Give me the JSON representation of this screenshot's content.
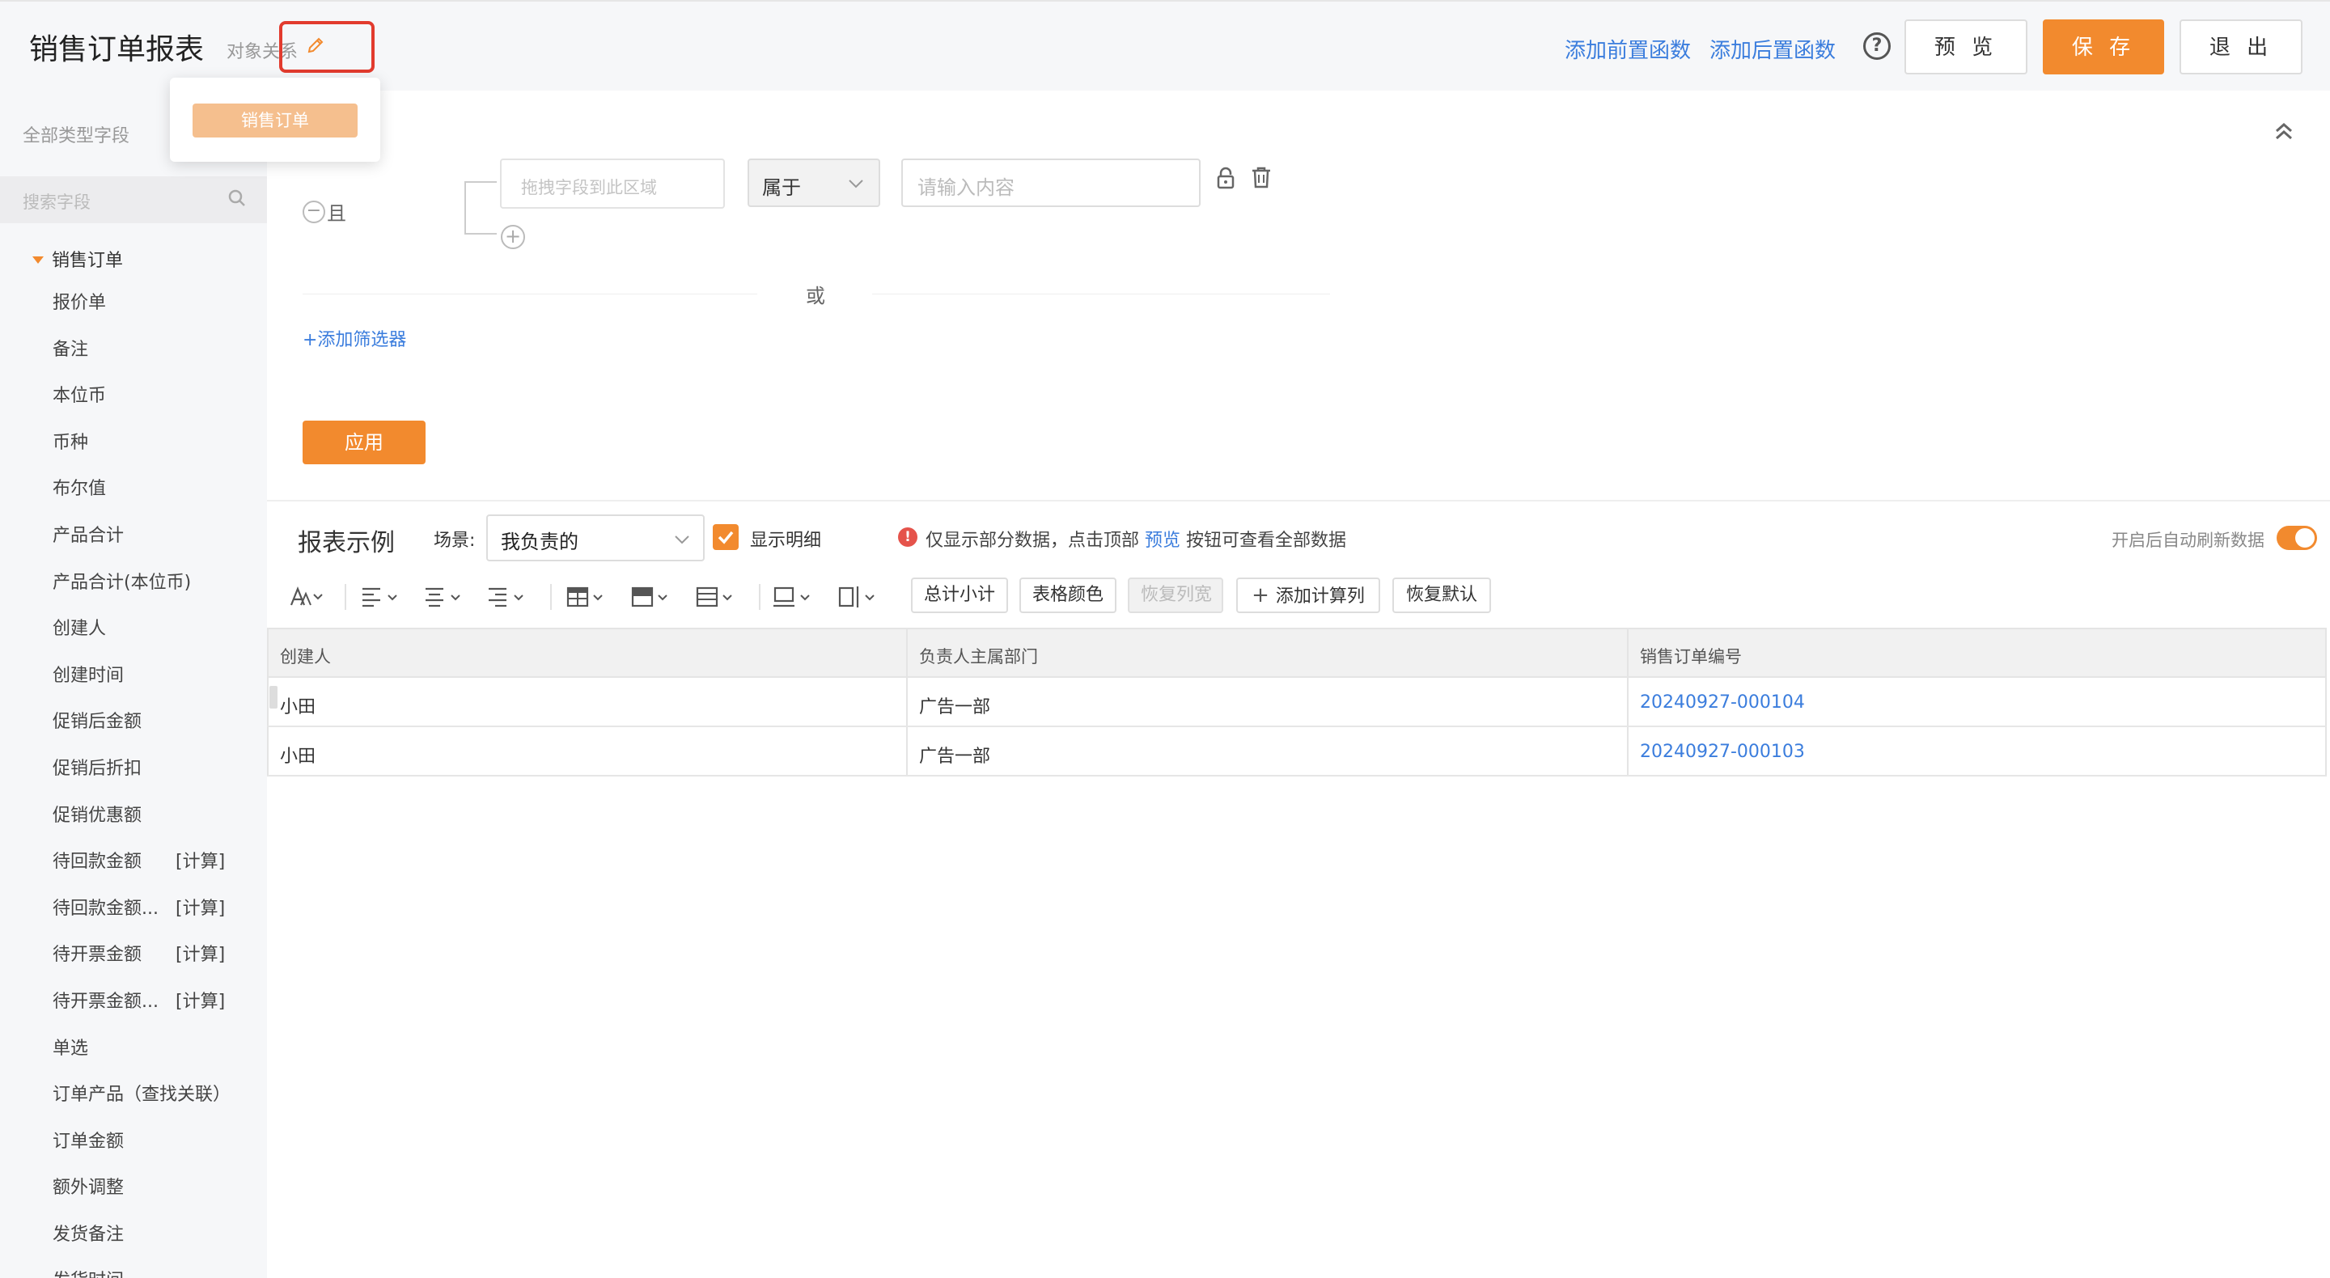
{
  "header": {
    "title": "销售订单报表",
    "object_relation": "对象关系",
    "add_pre_function": "添加前置函数",
    "add_post_function": "添加后置函数",
    "help_glyph": "?",
    "preview_label": "预 览",
    "save_label": "保 存",
    "exit_label": "退 出"
  },
  "popup": {
    "item": "销售订单"
  },
  "sidebar": {
    "all_fields_label": "全部类型字段",
    "search_placeholder": "搜索字段",
    "root": "销售订单",
    "fields": [
      {
        "label": "报价单",
        "tag": ""
      },
      {
        "label": "备注",
        "tag": ""
      },
      {
        "label": "本位币",
        "tag": ""
      },
      {
        "label": "币种",
        "tag": ""
      },
      {
        "label": "布尔值",
        "tag": ""
      },
      {
        "label": "产品合计",
        "tag": ""
      },
      {
        "label": "产品合计(本位币)",
        "tag": ""
      },
      {
        "label": "创建人",
        "tag": ""
      },
      {
        "label": "创建时间",
        "tag": ""
      },
      {
        "label": "促销后金额",
        "tag": ""
      },
      {
        "label": "促销后折扣",
        "tag": ""
      },
      {
        "label": "促销优惠额",
        "tag": ""
      },
      {
        "label": "待回款金额",
        "tag": "[计算]"
      },
      {
        "label": "待回款金额...",
        "tag": "[计算]"
      },
      {
        "label": "待开票金额",
        "tag": "[计算]"
      },
      {
        "label": "待开票金额...",
        "tag": "[计算]"
      },
      {
        "label": "单选",
        "tag": ""
      },
      {
        "label": "订单产品（查找关联）",
        "tag": ""
      },
      {
        "label": "订单金额",
        "tag": ""
      },
      {
        "label": "额外调整",
        "tag": ""
      },
      {
        "label": "发货备注",
        "tag": ""
      },
      {
        "label": "发货时间",
        "tag": ""
      }
    ]
  },
  "filter": {
    "minus_glyph": "−",
    "and_label": "且",
    "drop_zone_placeholder": "拖拽字段到此区域",
    "plus_glyph": "+",
    "operator": "属于",
    "value_placeholder": "请输入内容",
    "or_label": "或",
    "add_filter": "+添加筛选器",
    "apply_label": "应用"
  },
  "report": {
    "title": "报表示例",
    "scene_label": "场景:",
    "scene_value": "我负责的",
    "show_detail": "显示明细",
    "warn_glyph": "!",
    "notice_prefix": "仅显示部分数据，点击顶部",
    "notice_link": "预览",
    "notice_suffix": "按钮可查看全部数据",
    "auto_refresh": "开启后自动刷新数据"
  },
  "toolbar": {
    "subtotal": "总计小计",
    "table_color": "表格颜色",
    "restore_width": "恢复列宽",
    "add_calc_col": "添加计算列",
    "restore_default": "恢复默认"
  },
  "table": {
    "columns": [
      "创建人",
      "负责人主属部门",
      "销售订单编号"
    ],
    "rows": [
      [
        "小田",
        "广告一部",
        "20240927-000104"
      ],
      [
        "小田",
        "广告一部",
        "20240927-000103"
      ]
    ]
  },
  "colors": {
    "accent": "#f28a2e",
    "link": "#3b7ddd",
    "highlight_border": "#e23b2e"
  }
}
